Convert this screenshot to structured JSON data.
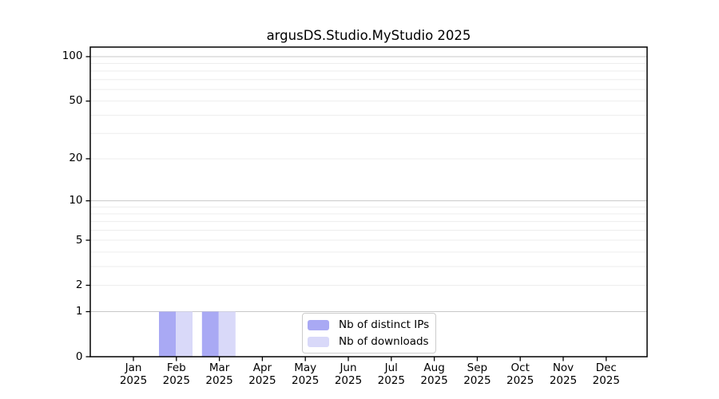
{
  "chart_data": {
    "type": "bar",
    "title": "argusDS.Studio.MyStudio 2025",
    "categories": [
      {
        "month": "Jan",
        "year": "2025"
      },
      {
        "month": "Feb",
        "year": "2025"
      },
      {
        "month": "Mar",
        "year": "2025"
      },
      {
        "month": "Apr",
        "year": "2025"
      },
      {
        "month": "May",
        "year": "2025"
      },
      {
        "month": "Jun",
        "year": "2025"
      },
      {
        "month": "Jul",
        "year": "2025"
      },
      {
        "month": "Aug",
        "year": "2025"
      },
      {
        "month": "Sep",
        "year": "2025"
      },
      {
        "month": "Oct",
        "year": "2025"
      },
      {
        "month": "Nov",
        "year": "2025"
      },
      {
        "month": "Dec",
        "year": "2025"
      }
    ],
    "series": [
      {
        "name": "Nb of distinct IPs",
        "color": "#a9a9f4",
        "values": [
          0,
          1,
          1,
          0,
          0,
          0,
          0,
          0,
          0,
          0,
          0,
          0
        ]
      },
      {
        "name": "Nb of downloads",
        "color": "#d9d9f9",
        "values": [
          0,
          1,
          1,
          0,
          0,
          0,
          0,
          0,
          0,
          0,
          0,
          0
        ]
      }
    ],
    "xlabel": "",
    "ylabel": "",
    "yscale": "log1p",
    "ylim": [
      0,
      116
    ],
    "yticks": [
      0,
      1,
      2,
      5,
      10,
      20,
      50,
      100
    ],
    "major_gridlines": [
      1,
      10,
      100
    ],
    "minor_gridlines": [
      2,
      3,
      4,
      5,
      6,
      7,
      8,
      9,
      20,
      30,
      40,
      50,
      60,
      70,
      80,
      90
    ],
    "grid": "on",
    "legend_position": "lower center",
    "colors": {
      "spine": "#000000",
      "major_grid": "#c8c8c8",
      "minor_grid": "#ededed",
      "tick": "#000000",
      "background": "#ffffff"
    }
  }
}
